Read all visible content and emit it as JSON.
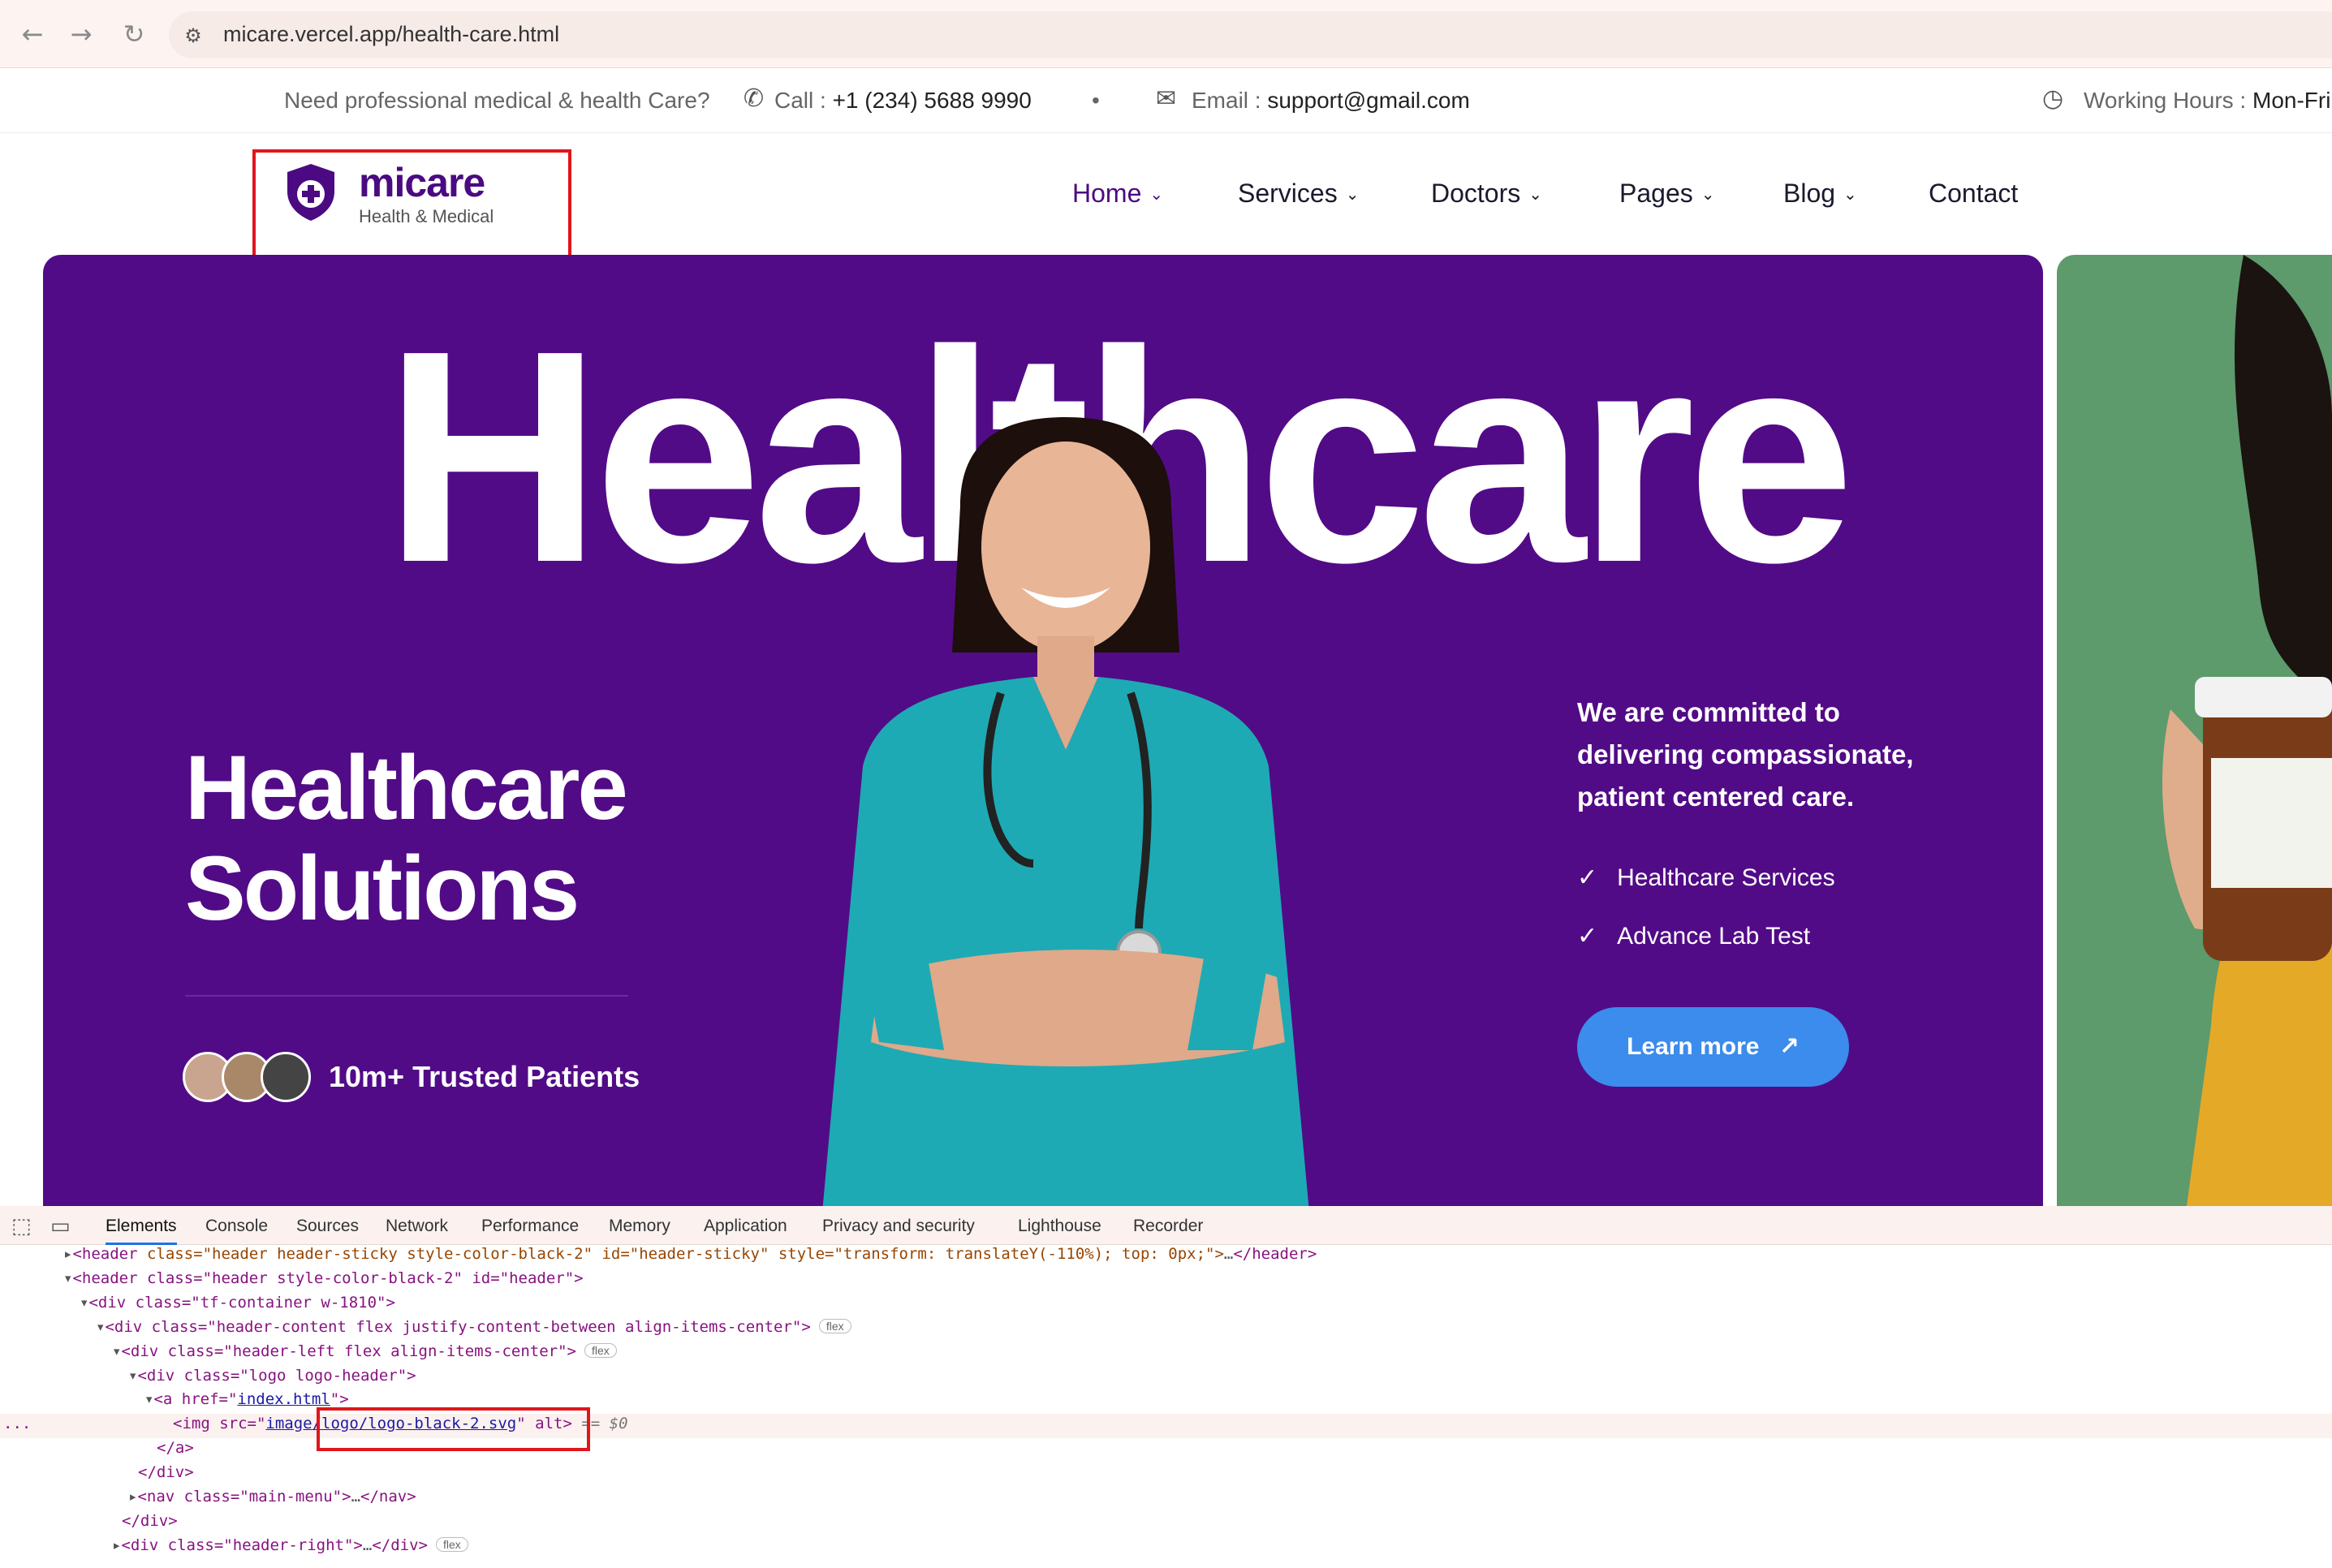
{
  "browser": {
    "url": "micare.vercel.app/health-care.html",
    "back_icon": "arrow-left-icon",
    "forward_icon": "arrow-right-icon",
    "reload_icon": "reload-icon",
    "site_info_icon": "tune-icon"
  },
  "topbar": {
    "tagline": "Need professional medical & health Care?",
    "call_label": "Call :",
    "call_value": "+1 (234) 5688 9990",
    "separator": "•",
    "email_label": "Email :",
    "email_value": "support@gmail.com",
    "hours_label": "Working Hours :",
    "hours_value": "Mon-Fri"
  },
  "header": {
    "logo_name": "micare",
    "logo_tag": "Health & Medical",
    "menu": [
      {
        "label": "Home",
        "active": true
      },
      {
        "label": "Services"
      },
      {
        "label": "Doctors"
      },
      {
        "label": "Pages"
      },
      {
        "label": "Blog"
      },
      {
        "label": "Contact"
      }
    ]
  },
  "hero": {
    "big_title": "Healthcare",
    "heading_line1": "Healthcare",
    "heading_line2": "Solutions",
    "trusted": "10m+ Trusted Patients",
    "committed": "We are committed to delivering compassionate, patient centered care.",
    "checks": [
      "Healthcare Services",
      "Advance Lab Test"
    ],
    "button": "Learn more",
    "button_icon": "arrow-up-right-icon"
  },
  "devtools": {
    "tabs": [
      "Elements",
      "Console",
      "Sources",
      "Network",
      "Performance",
      "Memory",
      "Application",
      "Privacy and security",
      "Lighthouse",
      "Recorder"
    ],
    "active_tab": "Elements",
    "lines": {
      "l1_tag": "<header",
      "l1_attrs": " class=\"header header-sticky style-color-black-2\" id=\"header-sticky\" style=\"transform: translateY(-110%); top: 0px;\">",
      "l1_end": "</header>",
      "l2": "<header class=\"header style-color-black-2\" id=\"header\">",
      "l3": "<div class=\"tf-container w-1810\">",
      "l4": "<div class=\"header-content flex justify-content-between align-items-center\">",
      "l5": "<div class=\"header-left flex align-items-center\">",
      "l6": "<div class=\"logo logo-header\">",
      "l7_pre": "<a href=\"",
      "l7_link": "index.html",
      "l7_post": "\">",
      "l8_pre": "<img src=\"",
      "l8_link": "image/logo/logo-black-2.svg",
      "l8_post": "\" alt>",
      "l8_ref": "== $0",
      "l9": "</a>",
      "l10": "</div>",
      "l11_pre": "<nav class=\"main-menu\">",
      "l11_post": "</nav>",
      "l12": "</div>",
      "l13_pre": "<div class=\"header-right\">",
      "l13_post": "</div>",
      "ellipsis": "…",
      "badge": "flex",
      "gutter": "..."
    }
  },
  "colors": {
    "brand": "#4b0a82",
    "hero_bg": "#520b87",
    "button": "#3b8cec",
    "highlight": "#e0161b"
  }
}
